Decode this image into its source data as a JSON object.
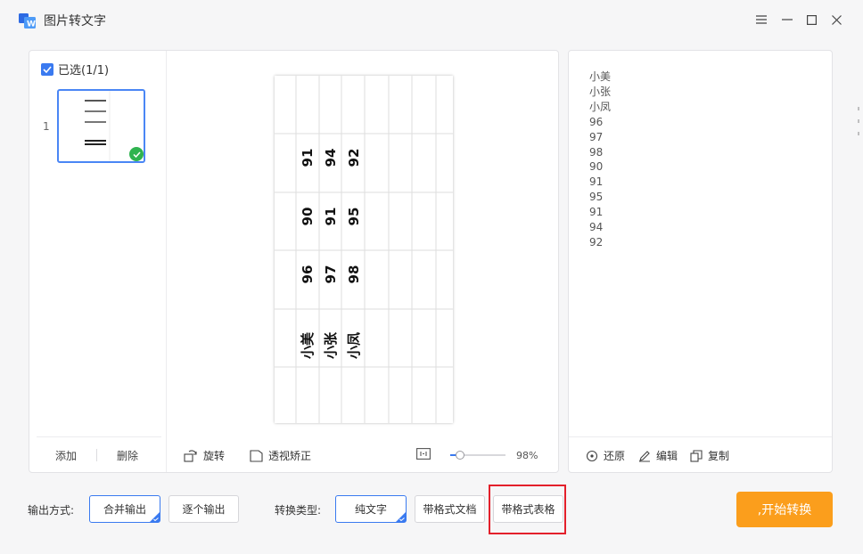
{
  "app": {
    "title": "图片转文字"
  },
  "window_controls": {
    "menu": "menu-icon",
    "minimize": "minimize-icon",
    "maximize": "maximize-icon",
    "close": "close-icon"
  },
  "thumbs": {
    "select_label": "已选(1/1)",
    "index": "1",
    "add_label": "添加",
    "delete_label": "删除"
  },
  "preview": {
    "columns": [
      {
        "name": "小美",
        "values": [
          "91",
          "90",
          "96"
        ]
      },
      {
        "name": "小张",
        "values": [
          "94",
          "91",
          "97"
        ]
      },
      {
        "name": "小凤",
        "values": [
          "92",
          "95",
          "98"
        ]
      }
    ]
  },
  "preview_toolbar": {
    "rotate_label": "旋转",
    "perspective_label": "透视矫正",
    "zoom": "98%"
  },
  "zoom_level": 0.17,
  "result": {
    "lines": "小美\n小张\n小凤\n96\n97\n98\n90\n91\n95\n91\n94\n92"
  },
  "result_toolbar": {
    "restore_label": "还原",
    "edit_label": "编辑",
    "copy_label": "复制"
  },
  "bottom": {
    "output_label": "输出方式:",
    "merge_label": "合并输出",
    "single_label": "逐个输出",
    "convert_label": "转换类型:",
    "plain_label": "纯文字",
    "doc_label": "带格式文档",
    "table_label": "带格式表格",
    "start_label": ",开始转换"
  },
  "colors": {
    "accent": "#3a7af0",
    "start": "#fb9e1c",
    "highlight": "#e3202b",
    "check": "#2fb34f"
  }
}
